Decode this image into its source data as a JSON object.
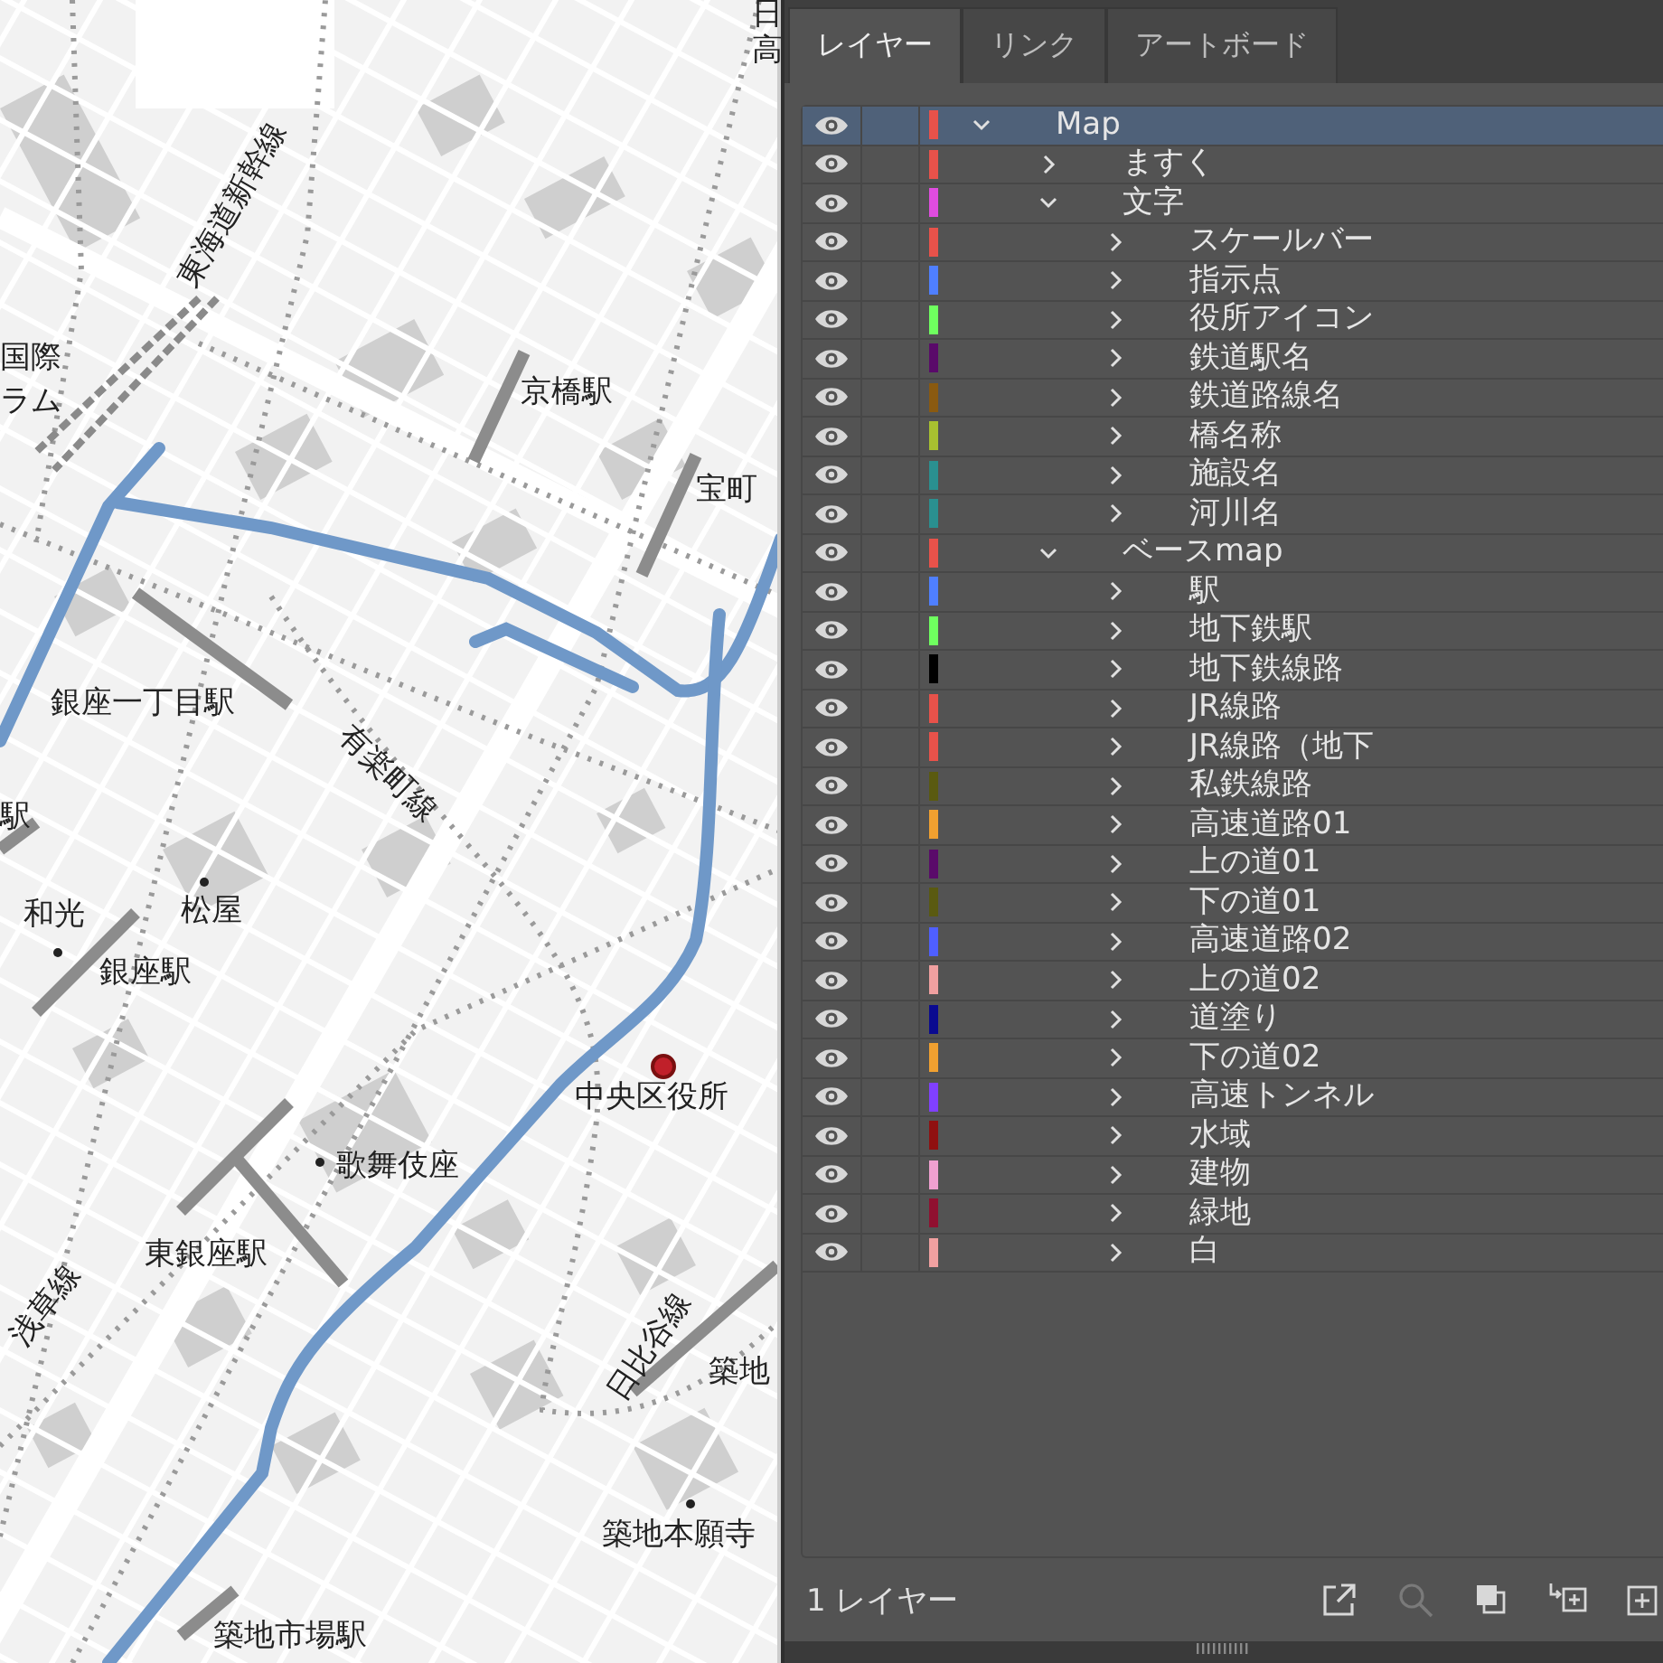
{
  "map": {
    "labels": [
      {
        "text": "日"
      },
      {
        "text": "高"
      },
      {
        "text": "東海道新幹線"
      },
      {
        "text": "国際"
      },
      {
        "text": "ラム"
      },
      {
        "text": "京橋駅"
      },
      {
        "text": "宝町"
      },
      {
        "text": "銀座一丁目駅"
      },
      {
        "text": "有楽町線"
      },
      {
        "text": "駅"
      },
      {
        "text": "和光"
      },
      {
        "text": "松屋"
      },
      {
        "text": "銀座駅"
      },
      {
        "text": "中央区役所"
      },
      {
        "text": "歌舞伎座"
      },
      {
        "text": "東銀座駅"
      },
      {
        "text": "浅草線"
      },
      {
        "text": "日比谷線"
      },
      {
        "text": "築地"
      },
      {
        "text": "築地本願寺"
      },
      {
        "text": "築地市場駅"
      }
    ]
  },
  "panel": {
    "tabs": [
      {
        "label": "レイヤー",
        "selected": true
      },
      {
        "label": "リンク",
        "selected": false
      },
      {
        "label": "アートボード",
        "selected": false
      }
    ],
    "layers": [
      {
        "name": "Map",
        "color": "#e8524a",
        "visible": true,
        "expanded": true,
        "selected": true,
        "children": [
          {
            "name": "ますく",
            "color": "#e8524a",
            "visible": true,
            "expanded": false,
            "selected": false
          },
          {
            "name": "文字",
            "color": "#e04ce0",
            "visible": true,
            "expanded": true,
            "selected": false,
            "children": [
              {
                "name": "スケールバー",
                "color": "#e8524a",
                "visible": true,
                "expanded": false,
                "selected": false
              },
              {
                "name": "指示点",
                "color": "#4f7fff",
                "visible": true,
                "expanded": false,
                "selected": false
              },
              {
                "name": "役所アイコン",
                "color": "#6fff5f",
                "visible": true,
                "expanded": false,
                "selected": false
              },
              {
                "name": "鉄道駅名",
                "color": "#5a0a6a",
                "visible": true,
                "expanded": false,
                "selected": false
              },
              {
                "name": "鉄道路線名",
                "color": "#8a5a10",
                "visible": true,
                "expanded": false,
                "selected": false
              },
              {
                "name": "橋名称",
                "color": "#a8c030",
                "visible": true,
                "expanded": false,
                "selected": false
              },
              {
                "name": "施設名",
                "color": "#2a9090",
                "visible": true,
                "expanded": false,
                "selected": false
              },
              {
                "name": "河川名",
                "color": "#2a9090",
                "visible": true,
                "expanded": false,
                "selected": false
              }
            ]
          },
          {
            "name": "ベースmap",
            "color": "#e8524a",
            "visible": true,
            "expanded": true,
            "selected": false,
            "children": [
              {
                "name": "駅",
                "color": "#4f7fff",
                "visible": true,
                "expanded": false,
                "selected": false
              },
              {
                "name": "地下鉄駅",
                "color": "#6fff5f",
                "visible": true,
                "expanded": false,
                "selected": false
              },
              {
                "name": "地下鉄線路",
                "color": "#000000",
                "visible": true,
                "expanded": false,
                "selected": false
              },
              {
                "name": "JR線路",
                "color": "#e8524a",
                "visible": true,
                "expanded": false,
                "selected": false
              },
              {
                "name": "JR線路（地下",
                "color": "#e8524a",
                "visible": true,
                "expanded": false,
                "selected": false
              },
              {
                "name": "私鉄線路",
                "color": "#5a5a10",
                "visible": true,
                "expanded": false,
                "selected": false
              },
              {
                "name": "高速道路01",
                "color": "#f0a030",
                "visible": true,
                "expanded": false,
                "selected": false
              },
              {
                "name": "上の道01",
                "color": "#5a0a6a",
                "visible": true,
                "expanded": false,
                "selected": false
              },
              {
                "name": "下の道01",
                "color": "#5a5a10",
                "visible": true,
                "expanded": false,
                "selected": false
              },
              {
                "name": "高速道路02",
                "color": "#4f5fff",
                "visible": true,
                "expanded": false,
                "selected": false
              },
              {
                "name": "上の道02",
                "color": "#f0a0a0",
                "visible": true,
                "expanded": false,
                "selected": false
              },
              {
                "name": "道塗り",
                "color": "#0a0a90",
                "visible": true,
                "expanded": false,
                "selected": false
              },
              {
                "name": "下の道02",
                "color": "#f0a030",
                "visible": true,
                "expanded": false,
                "selected": false
              },
              {
                "name": "高速トンネル",
                "color": "#8040ff",
                "visible": true,
                "expanded": false,
                "selected": false
              },
              {
                "name": "水域",
                "color": "#901010",
                "visible": true,
                "expanded": false,
                "selected": false
              },
              {
                "name": "建物",
                "color": "#f0a0d0",
                "visible": true,
                "expanded": false,
                "selected": false
              },
              {
                "name": "緑地",
                "color": "#901030",
                "visible": true,
                "expanded": false,
                "selected": false
              },
              {
                "name": "白",
                "color": "#f0a0a0",
                "visible": true,
                "expanded": false,
                "selected": false
              }
            ]
          }
        ]
      }
    ],
    "footer": {
      "count": "1 レイヤー",
      "tools": [
        {
          "kind": "export",
          "disabled": false
        },
        {
          "kind": "search",
          "disabled": true
        },
        {
          "kind": "mask",
          "disabled": false
        },
        {
          "kind": "sublayer",
          "disabled": false
        },
        {
          "kind": "layer",
          "disabled": false
        }
      ]
    }
  }
}
